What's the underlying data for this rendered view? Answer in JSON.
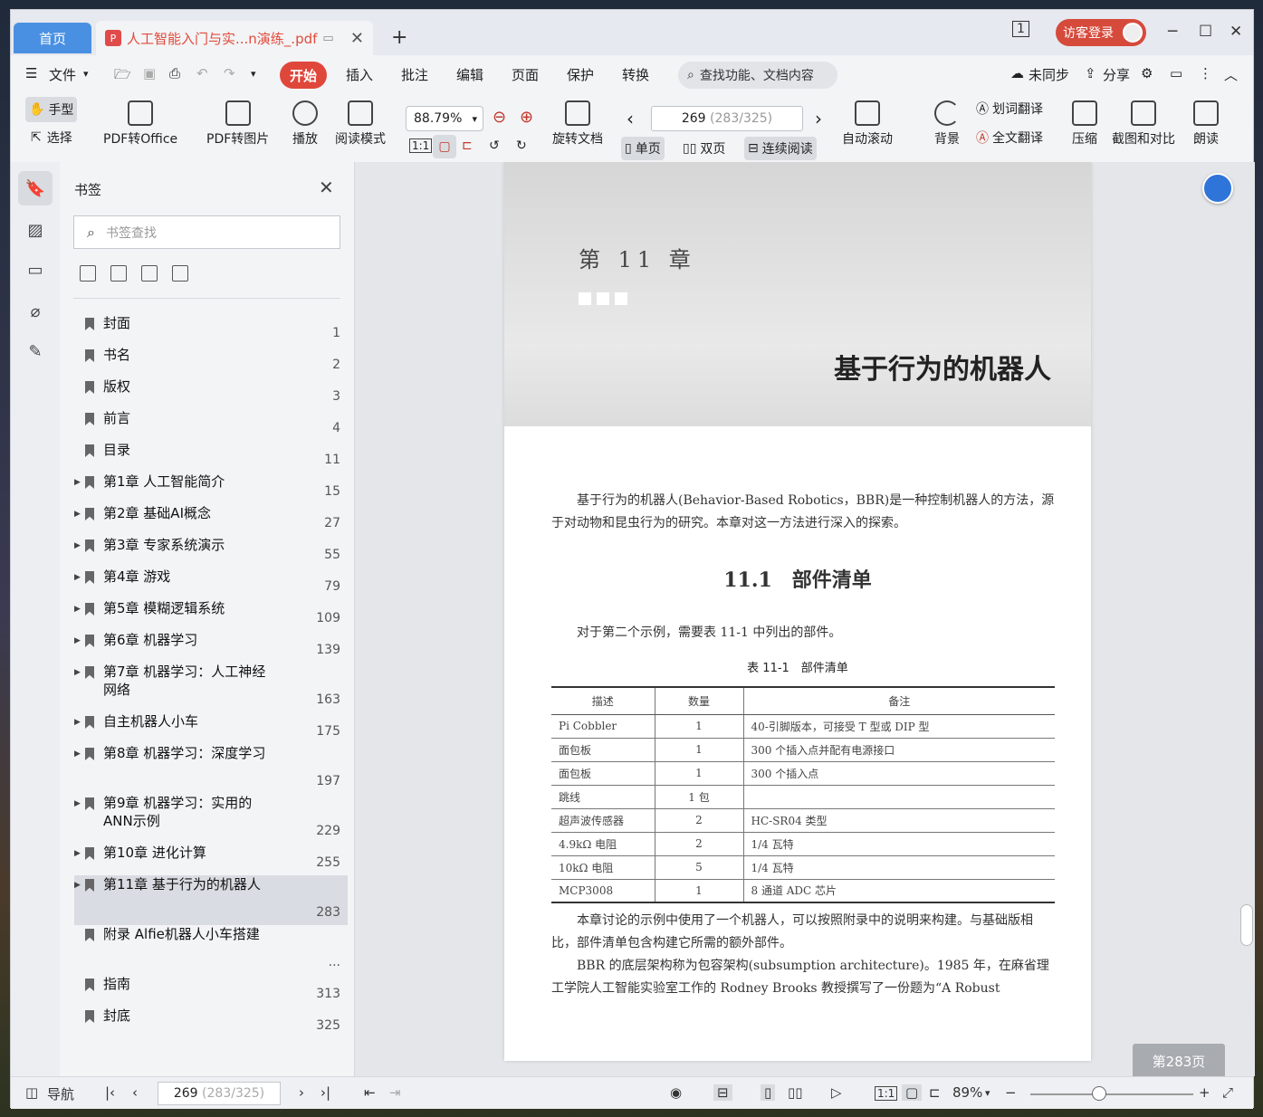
{
  "tabs": {
    "home": "首页",
    "doc_title": "人工智能入门与实...n演练_.pdf",
    "close": "✕",
    "new": "+"
  },
  "titlebar": {
    "visitor_login": "访客登录"
  },
  "menu": {
    "file": "文件",
    "start": "开始",
    "insert": "插入",
    "annotate": "批注",
    "edit": "编辑",
    "page": "页面",
    "protect": "保护",
    "convert": "转换",
    "search_placeholder": "查找功能、文档内容",
    "unsync": "未同步",
    "share": "分享"
  },
  "toolbar": {
    "hand": "手型",
    "select": "选择",
    "pdf_to_office": "PDF转Office",
    "pdf_to_image": "PDF转图片",
    "play": "播放",
    "read_mode": "阅读模式",
    "zoom": "88.79%",
    "rotate": "旋转文档",
    "page_current": "269",
    "page_info": "(283/325)",
    "single": "单页",
    "double": "双页",
    "continuous": "连续阅读",
    "auto_scroll": "自动滚动",
    "background": "背景",
    "word_translate": "划词翻译",
    "full_translate": "全文翻译",
    "compress": "压缩",
    "screenshot_compare": "截图和对比",
    "read_aloud": "朗读"
  },
  "panel": {
    "title": "书签",
    "search_placeholder": "书签查找"
  },
  "bookmarks": [
    {
      "label": "封面",
      "page": "1",
      "expandable": false
    },
    {
      "label": "书名",
      "page": "2",
      "expandable": false
    },
    {
      "label": "版权",
      "page": "3",
      "expandable": false
    },
    {
      "label": "前言",
      "page": "4",
      "expandable": false
    },
    {
      "label": "目录",
      "page": "11",
      "expandable": false
    },
    {
      "label": "第1章 人工智能简介",
      "page": "15",
      "expandable": true
    },
    {
      "label": "第2章 基础AI概念",
      "page": "27",
      "expandable": true
    },
    {
      "label": "第3章 专家系统演示",
      "page": "55",
      "expandable": true
    },
    {
      "label": "第4章 游戏",
      "page": "79",
      "expandable": true
    },
    {
      "label": "第5章 模糊逻辑系统",
      "page": "109",
      "expandable": true
    },
    {
      "label": "第6章 机器学习",
      "page": "139",
      "expandable": true
    },
    {
      "label": "第7章 机器学习：人工神经网络",
      "page": "163",
      "expandable": true
    },
    {
      "label": "自主机器人小车",
      "page": "175",
      "expandable": true
    },
    {
      "label": "第8章 机器学习：深度学习",
      "page": "197",
      "expandable": true
    },
    {
      "label": "第9章 机器学习：实用的ANN示例",
      "page": "229",
      "expandable": true
    },
    {
      "label": "第10章 进化计算",
      "page": "255",
      "expandable": true
    },
    {
      "label": "第11章 基于行为的机器人",
      "page": "283",
      "expandable": true,
      "selected": true
    },
    {
      "label": "附录 Alfie机器人小车搭建",
      "page": "...",
      "expandable": false
    },
    {
      "label": "指南",
      "page": "313",
      "expandable": false
    },
    {
      "label": "封底",
      "page": "325",
      "expandable": false
    }
  ],
  "doc": {
    "chapter_num": "第 11 章",
    "chapter_title": "基于行为的机器人",
    "intro": "基于行为的机器人(Behavior-Based Robotics，BBR)是一种控制机器人的方法，源于对动物和昆虫行为的研究。本章对这一方法进行深入的探索。",
    "section": "11.1　部件清单",
    "para1": "对于第二个示例，需要表 11-1 中列出的部件。",
    "table_caption": "表 11-1　部件清单",
    "table_headers": [
      "描述",
      "数量",
      "备注"
    ],
    "table_rows": [
      [
        "Pi Cobbler",
        "1",
        "40-引脚版本，可接受 T 型或 DIP 型"
      ],
      [
        "面包板",
        "1",
        "300 个插入点并配有电源接口"
      ],
      [
        "面包板",
        "1",
        "300 个插入点"
      ],
      [
        "跳线",
        "1 包",
        ""
      ],
      [
        "超声波传感器",
        "2",
        "HC-SR04 类型"
      ],
      [
        "4.9kΩ 电阻",
        "2",
        "1/4 瓦特"
      ],
      [
        "10kΩ 电阻",
        "5",
        "1/4 瓦特"
      ],
      [
        "MCP3008",
        "1",
        "8 通道 ADC 芯片"
      ]
    ],
    "para2": "本章讨论的示例中使用了一个机器人，可以按照附录中的说明来构建。与基础版相比，部件清单包含构建它所需的额外部件。",
    "para3": "BBR 的底层架构称为包容架构(subsumption architecture)。1985 年，在麻省理工学院人工智能实验室工作的 Rodney Brooks 教授撰写了一份题为“A Robust",
    "page_badge": "第283页"
  },
  "status": {
    "nav": "导航",
    "page_current": "269",
    "page_info": "(283/325)",
    "zoom": "89%"
  }
}
